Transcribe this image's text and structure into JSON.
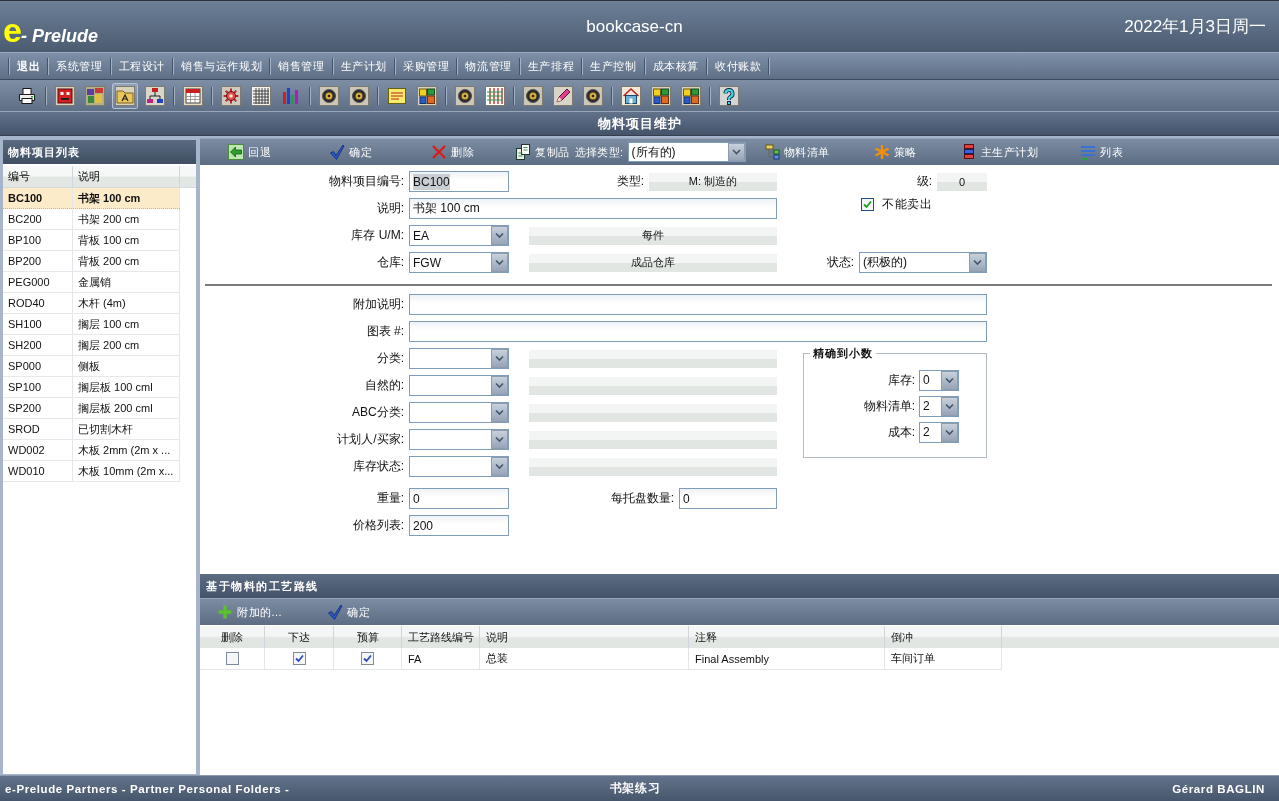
{
  "header": {
    "logo": {
      "mark": "e",
      "text": "- Prelude"
    },
    "title": "bookcase-cn",
    "date": "2022年1月3日周一"
  },
  "menu": [
    {
      "label": "退出",
      "kind": "command"
    },
    {
      "label": "系统管理",
      "kind": "module"
    },
    {
      "label": "工程设计",
      "kind": "module"
    },
    {
      "label": "销售与运作规划",
      "kind": "module"
    },
    {
      "label": "销售管理",
      "kind": "module"
    },
    {
      "label": "生产计划",
      "kind": "module"
    },
    {
      "label": "采购管理",
      "kind": "module"
    },
    {
      "label": "物流管理",
      "kind": "module"
    },
    {
      "label": "生产排程",
      "kind": "module"
    },
    {
      "label": "生产控制",
      "kind": "module"
    },
    {
      "label": "成本核算",
      "kind": "module"
    },
    {
      "label": "收付账款",
      "kind": "module"
    }
  ],
  "toolbar": {
    "groups": [
      {
        "buttons": [
          {
            "selected": false
          }
        ]
      },
      {
        "buttons": [
          {
            "selected": false
          },
          {
            "selected": false
          },
          {
            "selected": true
          },
          {
            "selected": false
          }
        ]
      },
      {
        "buttons": [
          {
            "selected": false
          }
        ]
      },
      {
        "buttons": [
          {
            "selected": false
          },
          {
            "selected": false
          },
          {
            "selected": false
          }
        ]
      },
      {
        "buttons": [
          {
            "selected": false
          },
          {
            "selected": false
          }
        ]
      },
      {
        "buttons": [
          {
            "selected": false
          },
          {
            "selected": false
          }
        ]
      },
      {
        "buttons": [
          {
            "selected": false
          },
          {
            "selected": false
          }
        ]
      },
      {
        "buttons": [
          {
            "selected": false
          },
          {
            "selected": false
          },
          {
            "selected": false
          }
        ]
      },
      {
        "buttons": [
          {
            "selected": false
          },
          {
            "selected": false
          },
          {
            "selected": false
          }
        ]
      },
      {
        "buttons": [
          {
            "selected": false
          }
        ]
      }
    ]
  },
  "page_title": "物料项目维护",
  "item_list": {
    "title": "物料项目列表",
    "columns": [
      "编号",
      "说明"
    ],
    "rows": [
      {
        "code": "BC100",
        "description": "书架 100 cm",
        "selected": true
      },
      {
        "code": "BC200",
        "description": "书架 200 cm",
        "selected": false
      },
      {
        "code": "BP100",
        "description": "背板 100 cm",
        "selected": false
      },
      {
        "code": "BP200",
        "description": "背板 200 cm",
        "selected": false
      },
      {
        "code": "PEG000",
        "description": "金属销",
        "selected": false
      },
      {
        "code": "ROD40",
        "description": "木杆 (4m)",
        "selected": false
      },
      {
        "code": "SH100",
        "description": "搁层 100 cm",
        "selected": false
      },
      {
        "code": "SH200",
        "description": "搁层 200 cm",
        "selected": false
      },
      {
        "code": "SP000",
        "description": "侧板",
        "selected": false
      },
      {
        "code": "SP100",
        "description": "搁层板 100 cml",
        "selected": false
      },
      {
        "code": "SP200",
        "description": "搁层板 200 cml",
        "selected": false
      },
      {
        "code": "SROD",
        "description": "已切割木杆",
        "selected": false
      },
      {
        "code": "WD002",
        "description": "木板 2mm (2m x ...",
        "selected": false
      },
      {
        "code": "WD010",
        "description": "木板 10mm (2m x...",
        "selected": false
      }
    ]
  },
  "actions": {
    "buttons": [
      {
        "label": "回退"
      },
      {
        "label": "确定"
      },
      {
        "label": "删除"
      },
      {
        "label": "复制品"
      }
    ],
    "type_filter": {
      "label": "选择类型:",
      "value": "(所有的)"
    },
    "more_buttons": [
      {
        "label": "物料清单"
      },
      {
        "label": "策略"
      },
      {
        "label": "主生产计划"
      },
      {
        "label": "列表"
      }
    ]
  },
  "form": {
    "item_number": {
      "label": "物料项目编号:",
      "value": "BC100",
      "text_selected": true
    },
    "type": {
      "label": "类型:",
      "value": "M: 制造的"
    },
    "level": {
      "label": "级:",
      "value": "0"
    },
    "description": {
      "label": "说明:",
      "value": "书架 100 cm"
    },
    "not_saleable": {
      "label": "不能卖出",
      "checked": true
    },
    "stock_um": {
      "label": "库存 U/M:",
      "value": "EA",
      "meaning": "每件"
    },
    "warehouse": {
      "label": "仓库:",
      "value": "FGW",
      "meaning": "成品仓库"
    },
    "status": {
      "label": "状态:",
      "value": "(积极的)"
    },
    "extra_description": {
      "label": "附加说明:"
    },
    "drawing": {
      "label": "图表 #:"
    },
    "codes": [
      {
        "label": "分类:"
      },
      {
        "label": "自然的:"
      },
      {
        "label": "ABC分类:"
      },
      {
        "label": "计划人/买家:"
      },
      {
        "label": "库存状态:"
      }
    ],
    "weight": {
      "label": "重量:",
      "value": "0"
    },
    "per_pallet": {
      "label": "每托盘数量:",
      "value": "0"
    },
    "price_list": {
      "label": "价格列表:",
      "value": "200"
    }
  },
  "precision": {
    "legend": "精确到小数",
    "fields": [
      {
        "label": "库存:",
        "value": "0"
      },
      {
        "label": "物料清单:",
        "value": "2"
      },
      {
        "label": "成本:",
        "value": "2"
      }
    ]
  },
  "routing": {
    "title": "基于物料的工艺路线",
    "actions": [
      {
        "label": "附加的..."
      },
      {
        "label": "确定"
      }
    ],
    "columns": [
      "删除",
      "下达",
      "预算",
      "工艺路线编号",
      "说明",
      "注释",
      "倒冲"
    ],
    "rows": [
      {
        "delete": false,
        "release": true,
        "budget": true,
        "routing_code": "FA",
        "description": "总装",
        "note": "Final Assembly",
        "backflush": "车间订单"
      }
    ]
  },
  "status_bar": {
    "left": "e-Prelude Partners - Partner Personal Folders -",
    "center": "书架练习",
    "right": "Gérard BAGLIN"
  }
}
